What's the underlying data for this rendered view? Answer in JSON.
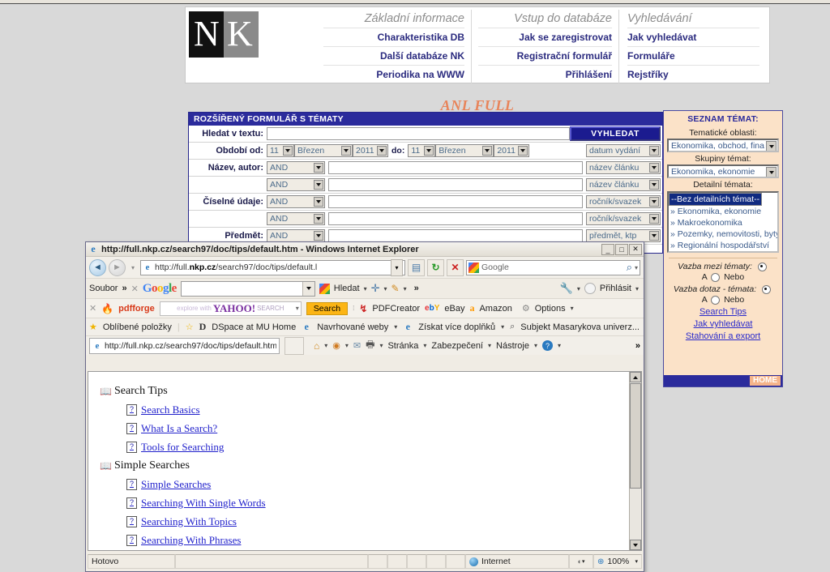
{
  "site": {
    "logo": {
      "left": "N",
      "right": "K"
    },
    "nav_columns": [
      {
        "title": "Základní informace",
        "links": [
          "Charakteristika DB",
          "Další databáze NK",
          "Periodika na WWW"
        ]
      },
      {
        "title": "Vstup do databáze",
        "links": [
          "Jak se zaregistrovat",
          "Registrační formulář",
          "Přihlášení"
        ]
      },
      {
        "title": "Vyhledávání",
        "links": [
          "Jak vyhledávat",
          "Formuláře",
          "Rejstříky"
        ]
      }
    ],
    "banner": "ANL FULL",
    "form": {
      "title": "ROZŠÍŘENÝ FORMULÁŘ S TÉMATY",
      "search_label": "Hledat v textu:",
      "search_value": "",
      "search_button": "VYHLEDAT",
      "period_label": "Období od:",
      "period_to_label": "do:",
      "from_day": "11",
      "from_month": "Březen",
      "from_year": "2011",
      "to_day": "11",
      "to_month": "Březen",
      "to_year": "2011",
      "date_field": "datum vydání",
      "rows": [
        {
          "label": "Název, autor:",
          "op": "AND",
          "value": "",
          "field": "název článku"
        },
        {
          "label": "",
          "op": "AND",
          "value": "",
          "field": "název článku"
        },
        {
          "label": "Číselné údaje:",
          "op": "AND",
          "value": "",
          "field": "ročník/svazek"
        },
        {
          "label": "",
          "op": "AND",
          "value": "",
          "field": "ročník/svazek"
        },
        {
          "label": "Předmět:",
          "op": "AND",
          "value": "",
          "field": "předmět, ktp"
        }
      ]
    },
    "themes": {
      "title": "SEZNAM TÉMAT:",
      "area_label": "Tematické oblasti:",
      "area_value": "Ekonomika, obchod, fina",
      "group_label": "Skupiny témat:",
      "group_value": "Ekonomika, ekonomie",
      "detail_label": "Detailní témata:",
      "detail_items": [
        "--Bez detailních témat--",
        "» Ekonomika, ekonomie",
        "» Makroekonomika",
        "» Pozemky, nemovitosti, byty",
        "» Regionální hospodářství"
      ],
      "detail_selected_index": 0,
      "link_themes_label": "Vazba mezi tématy:",
      "link_query_label": "Vazba dotaz - témata:",
      "opt_and": "A",
      "opt_or": "Nebo",
      "links": [
        "Search Tips",
        "Jak vyhledávat",
        "Stahování a export"
      ],
      "home": "HOME"
    }
  },
  "ie": {
    "title": "http://full.nkp.cz/search97/doc/tips/default.htm - Windows Internet Explorer",
    "window_buttons": [
      "_",
      "□",
      "✕"
    ],
    "address": {
      "prefix": "http://full.",
      "domain": "nkp.cz",
      "path": "/search97/doc/tips/default.l"
    },
    "search_placeholder": "Google",
    "menu": {
      "file": "Soubor",
      "chevron": "»",
      "google_brand": "Google",
      "google_value": "",
      "hledat": "Hledat",
      "prihlasit": "Přihlásit"
    },
    "toolbar2": {
      "pdfforge": "pdfforge",
      "yahoo_hint": "explore with",
      "yahoo": "YAHOO!",
      "yahoo_search": "SEARCH",
      "search_button": "Search",
      "pdfcreator": "PDFCreator",
      "ebay": "eBay",
      "amazon": "Amazon",
      "options": "Options"
    },
    "favorites": {
      "label": "Oblíbené položky",
      "items": [
        "DSpace at MU Home",
        "Navrhované weby",
        "Získat více doplňků",
        "Subjekt Masarykova univerz..."
      ]
    },
    "command": {
      "tab_title": "http://full.nkp.cz/search97/doc/tips/default.htm",
      "stranka": "Stránka",
      "zabezpeceni": "Zabezpečení",
      "nastroje": "Nástroje",
      "overflow": "»"
    },
    "content": {
      "sections": [
        {
          "heading": "Search Tips",
          "links": [
            "Search Basics",
            "What Is a Search?",
            "Tools for Searching"
          ]
        },
        {
          "heading": "Simple Searches",
          "links": [
            "Simple Searches",
            "Searching With Single Words",
            "Searching With Topics",
            "Searching With Phrases"
          ]
        }
      ]
    },
    "status": {
      "left": "Hotovo",
      "zone": "Internet",
      "zoom": "100%"
    }
  }
}
